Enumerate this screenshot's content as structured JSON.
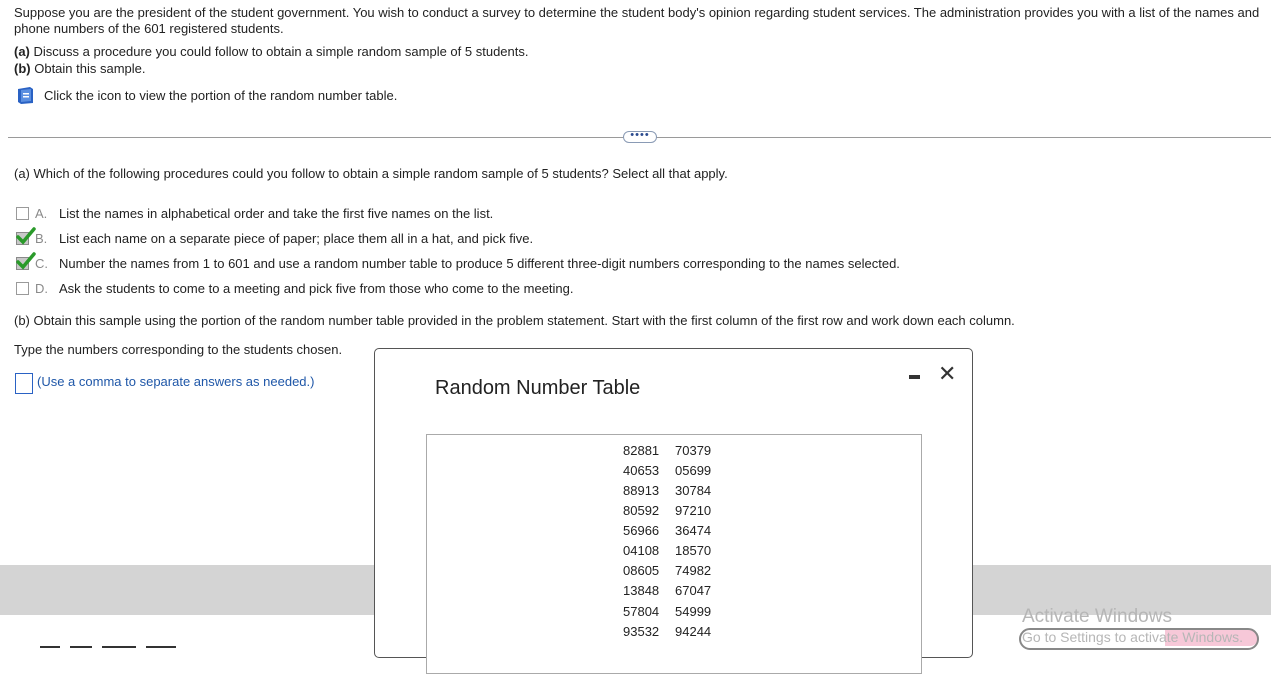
{
  "intro": {
    "line1": "Suppose you are the president of the student government. You wish to conduct a survey to determine the student body's opinion regarding student services. The administration provides you with a list of the names and",
    "line2": "phone numbers of the 601 registered students.",
    "part_a_label": "(a)",
    "part_a_text": " Discuss a procedure you could follow to obtain a simple random sample of 5 students.",
    "part_b_label": "(b)",
    "part_b_text": " Obtain this sample.",
    "icon_instruction": "Click the icon to view the portion of the random number table."
  },
  "more_button": "••••",
  "question_a": {
    "label": "(a)",
    "text": " Which of the following procedures could you follow to obtain a simple random sample of 5 students? Select all that apply.",
    "options": [
      {
        "letter": "A.",
        "text": "List the names in alphabetical order and take the first five names on the list.",
        "checked": false
      },
      {
        "letter": "B.",
        "text": "List each name on a separate piece of paper; place them all in a hat, and pick five.",
        "checked": true
      },
      {
        "letter": "C.",
        "text": "Number the names from 1 to 601 and use a random number table to produce 5 different three-digit numbers corresponding to the names selected.",
        "checked": true
      },
      {
        "letter": "D.",
        "text": "Ask the students to come to a meeting and pick five from those who come to the meeting.",
        "checked": false
      }
    ]
  },
  "question_b": {
    "label": "(b)",
    "text": " Obtain this sample using the portion of the random number table provided in the problem statement. Start with the first column of the first row and work down each column.",
    "type_prompt": "Type the numbers corresponding to the students chosen.",
    "hint": "(Use a comma to separate answers as needed.)",
    "answer_value": ""
  },
  "popup": {
    "title": "Random Number Table",
    "minimize_icon": "minimize-icon",
    "close_glyph": "✕",
    "rows": [
      [
        "82881",
        "70379"
      ],
      [
        "40653",
        "05699"
      ],
      [
        "88913",
        "30784"
      ],
      [
        "80592",
        "97210"
      ],
      [
        "56966",
        "36474"
      ],
      [
        "04108",
        "18570"
      ],
      [
        "08605",
        "74982"
      ],
      [
        "13848",
        "67047"
      ],
      [
        "57804",
        "54999"
      ],
      [
        "93532",
        "94244"
      ]
    ]
  },
  "watermark": {
    "line1": "Activate Windows",
    "line2": "Go to Settings to activate Windows."
  },
  "colors": {
    "accent": "#2a62c4",
    "hint": "#1f57a8",
    "check": "#2a9a2a"
  }
}
